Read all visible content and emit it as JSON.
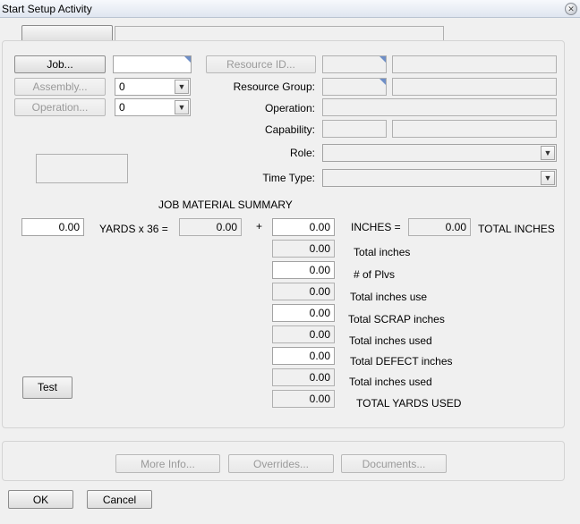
{
  "window": {
    "title": "Start Setup Activity"
  },
  "header": {
    "tab_label": "",
    "description": ""
  },
  "job": {
    "job_button": "Job...",
    "job_value": "",
    "assembly_button": "Assembly...",
    "assembly_value": "0",
    "operation_button": "Operation...",
    "operation_value": "0"
  },
  "resource": {
    "resource_id_button": "Resource ID...",
    "resource_id_value": "",
    "resource_id_desc": "",
    "resource_group_label": "Resource Group:",
    "resource_group_value": "",
    "resource_group_desc": "",
    "operation_label": "Operation:",
    "operation_value": "",
    "capability_label": "Capability:",
    "capability_value": "",
    "capability_desc": "",
    "role_label": "Role:",
    "role_value": "",
    "time_type_label": "Time Type:",
    "time_type_value": ""
  },
  "material": {
    "heading": "JOB MATERIAL SUMMARY",
    "yards_value": "0.00",
    "yards_label": "YARDS x 36 =",
    "yards_result": "0.00",
    "plus": "+",
    "inches_value": "0.00",
    "inches_label": "INCHES =",
    "total_inches_value": "0.00",
    "total_inches_label": "TOTAL INCHES",
    "rows": [
      {
        "value": "0.00",
        "label": "Total inches"
      },
      {
        "value": "0.00",
        "label": "# of Plvs"
      },
      {
        "value": "0.00",
        "label": "Total inches use"
      },
      {
        "value": "0.00",
        "label": "Total SCRAP inches"
      },
      {
        "value": "0.00",
        "label": "Total inches used"
      },
      {
        "value": "0.00",
        "label": "Total DEFECT inches"
      },
      {
        "value": "0.00",
        "label": "Total inches used"
      },
      {
        "value": "0.00",
        "label": "TOTAL YARDS USED"
      }
    ],
    "test_button": "Test"
  },
  "footer": {
    "more_info": "More Info...",
    "overrides": "Overrides...",
    "documents": "Documents...",
    "ok": "OK",
    "cancel": "Cancel"
  }
}
